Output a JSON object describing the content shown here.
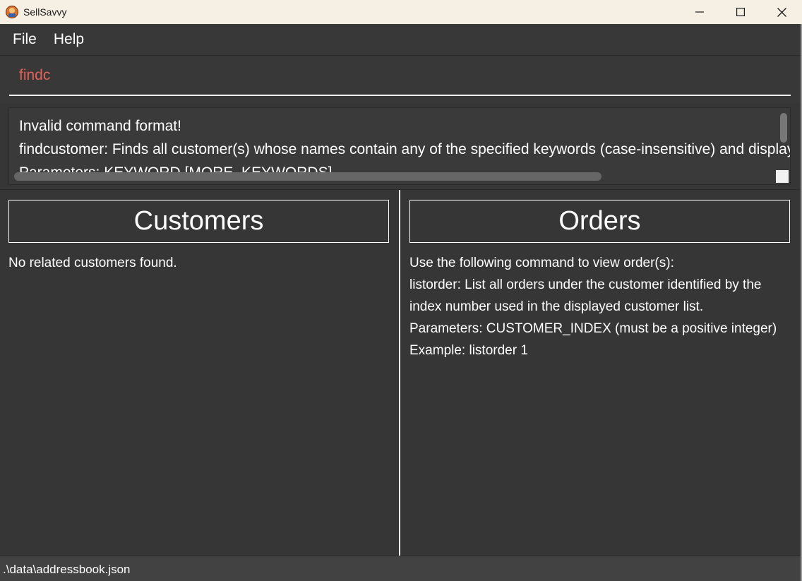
{
  "window": {
    "title": "SellSavvy"
  },
  "menu": {
    "items": [
      {
        "label": "File"
      },
      {
        "label": "Help"
      }
    ]
  },
  "command": {
    "value": "findc"
  },
  "result": {
    "lines": [
      "Invalid command format!",
      "findcustomer: Finds all customer(s) whose names contain any of the specified keywords (case-insensitive) and displays t",
      "Parameters: KEYWORD [MORE_KEYWORDS]..."
    ]
  },
  "customers_panel": {
    "title": "Customers",
    "message": "No related customers found."
  },
  "orders_panel": {
    "title": "Orders",
    "lines": [
      "Use the following command to view order(s):",
      "listorder: List all orders under the customer identified by the",
      "index number used in the displayed customer list.",
      "Parameters: CUSTOMER_INDEX (must be a positive integer)",
      "Example: listorder 1"
    ]
  },
  "status": {
    "path": ".\\data\\addressbook.json"
  },
  "colors": {
    "background": "#363636",
    "titlebar": "#f6f0e4",
    "command_text": "#e0625a",
    "text": "#ffffff"
  },
  "icons": {
    "app": "sellsavvy-app-icon",
    "minimize": "minimize-icon",
    "maximize": "maximize-icon",
    "close": "close-icon"
  }
}
